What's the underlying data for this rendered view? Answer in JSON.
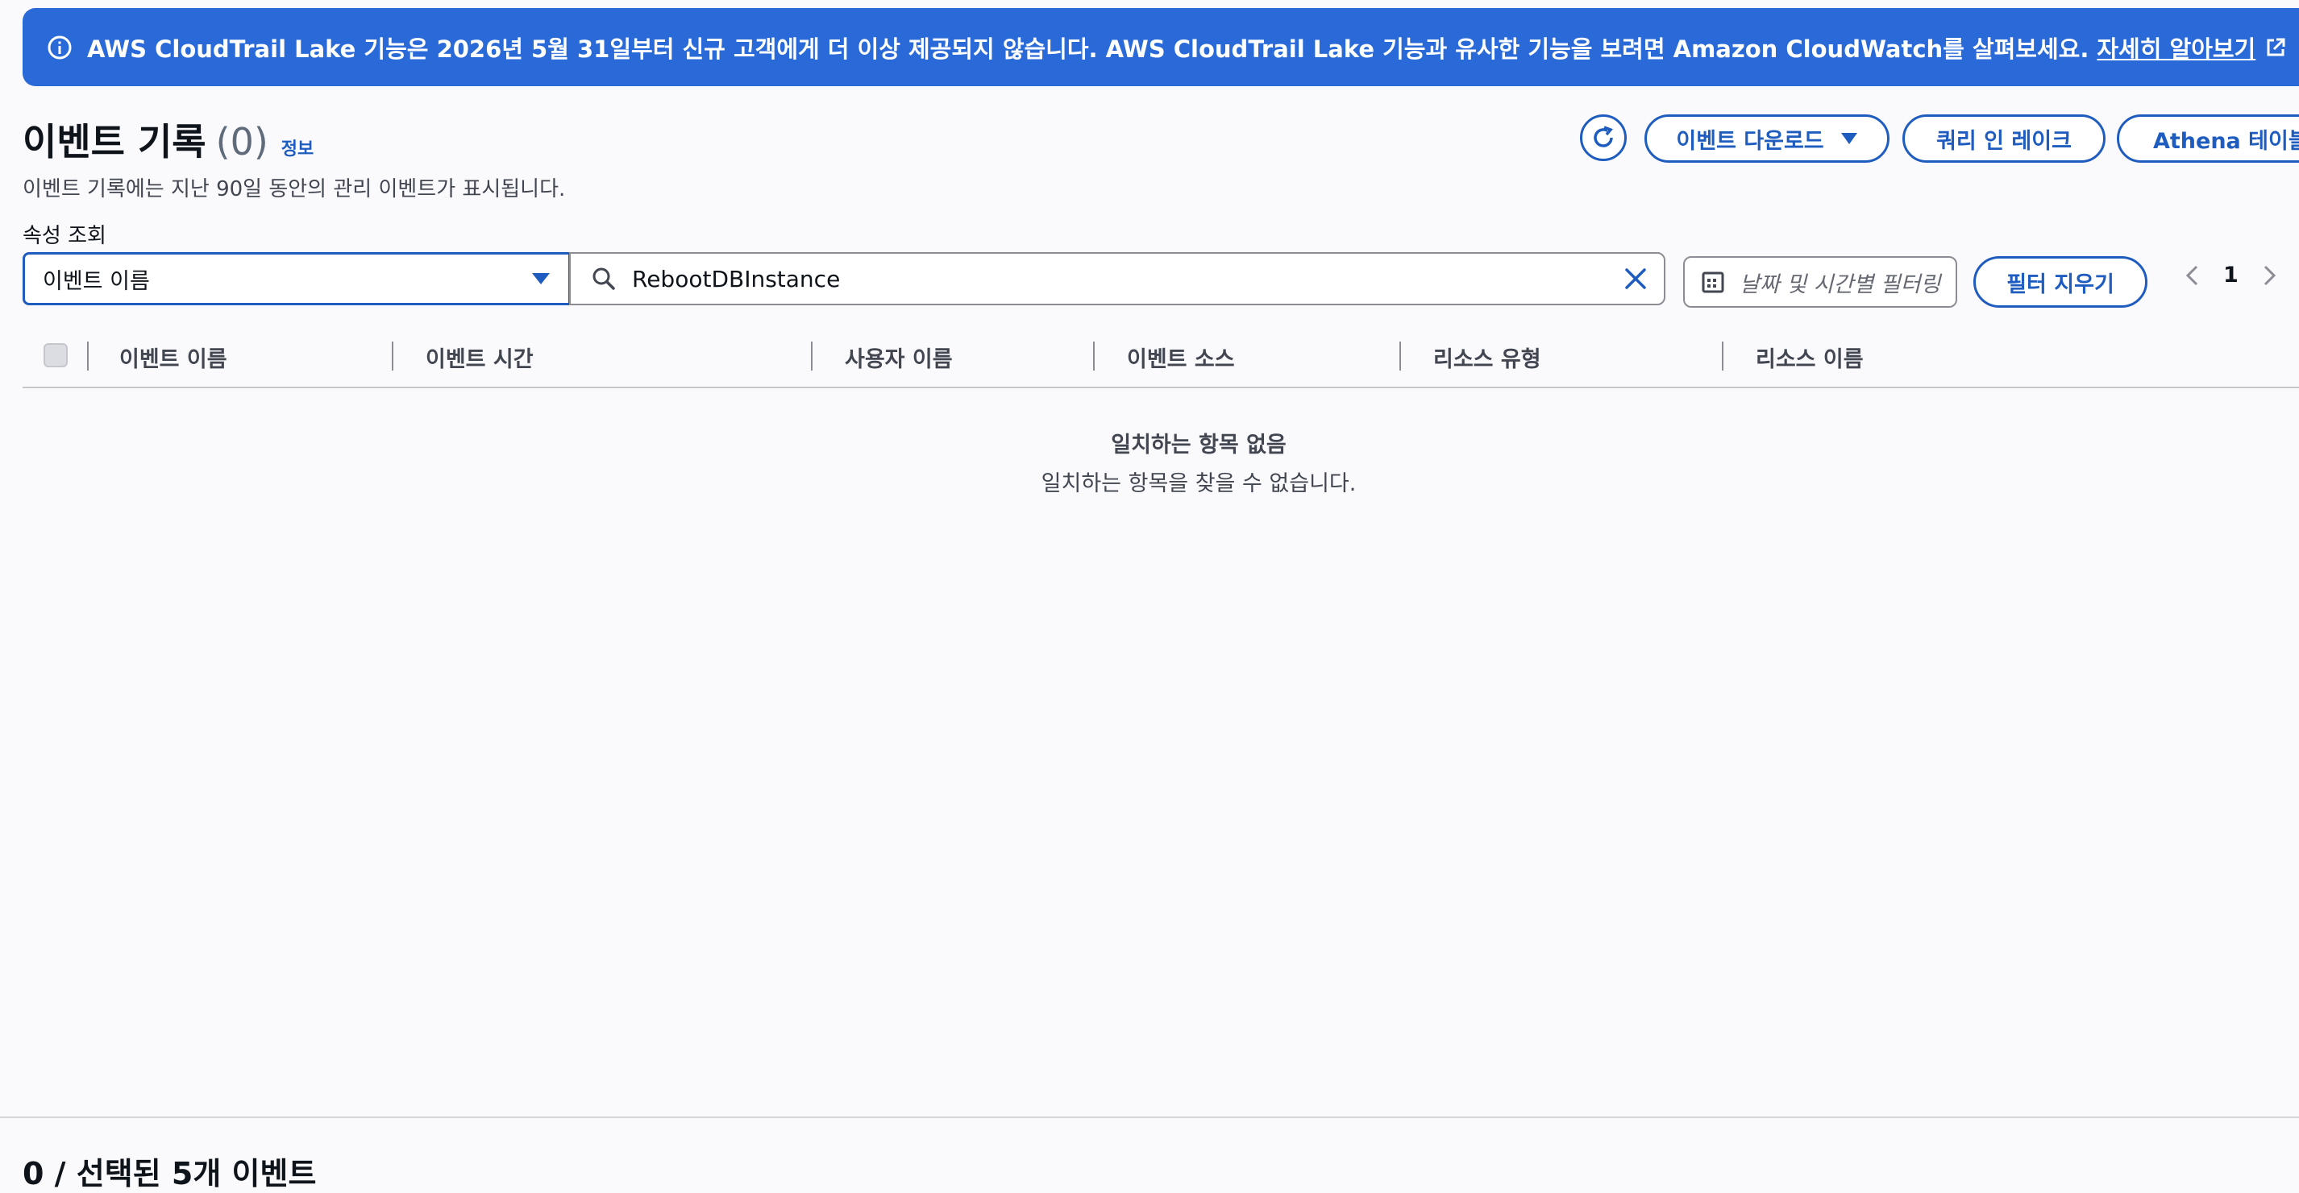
{
  "banner": {
    "message": "AWS CloudTrail Lake 기능은 2026년 5월 31일부터 신규 고객에게 더 이상 제공되지 않습니다. AWS CloudTrail Lake 기능과 유사한 기능을 보려면 Amazon CloudWatch를 살펴보세요.",
    "link_label": "자세히 알아보기",
    "color": "#2a6ad8"
  },
  "header": {
    "title": "이벤트 기록",
    "count": "(0)",
    "info_label": "정보",
    "description": "이벤트 기록에는 지난 90일 동안의 관리 이벤트가 표시됩니다."
  },
  "toolbar": {
    "download_label": "이벤트 다운로드",
    "query_lake_label": "쿼리 인 레이크",
    "athena_label": "Athena 테이블"
  },
  "filter": {
    "property_label": "속성 조회",
    "property_value": "이벤트 이름",
    "search_value": "RebootDBInstance",
    "date_placeholder": "날짜 및 시간별 필터링",
    "clear_label": "필터 지우기"
  },
  "pagination": {
    "current_page": "1"
  },
  "table": {
    "columns": [
      "이벤트 이름",
      "이벤트 시간",
      "사용자 이름",
      "이벤트 소스",
      "리소스 유형",
      "리소스 이름"
    ],
    "rows": [],
    "empty_title": "일치하는 항목 없음",
    "empty_message": "일치하는 항목을 찾을 수 없습니다."
  },
  "bottom_section": {
    "title": "0 / 선택된 5개 이벤트"
  },
  "colors": {
    "accent": "#1f5cbf",
    "banner": "#2a6ad8",
    "background": "#fafafd"
  }
}
